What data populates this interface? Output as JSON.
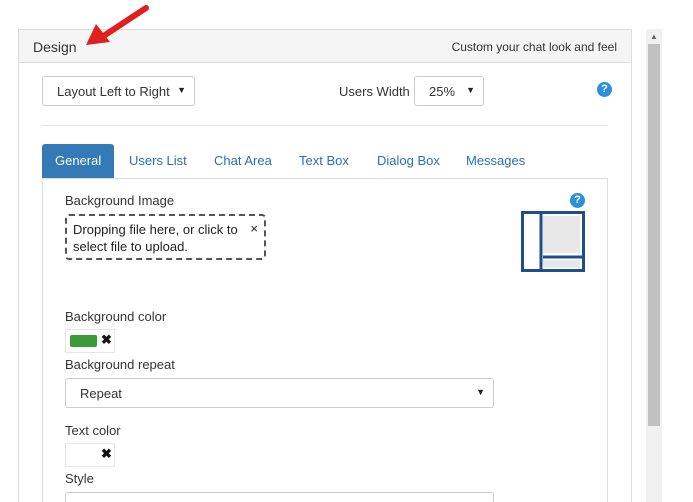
{
  "panel": {
    "title": "Design",
    "subtitle": "Custom your chat look and feel"
  },
  "layout": {
    "select_value": "Layout Left to Right",
    "users_width_label": "Users Width",
    "users_width_value": "25%",
    "help": "?"
  },
  "tabs": [
    {
      "label": "General",
      "active": true
    },
    {
      "label": "Users List",
      "active": false
    },
    {
      "label": "Chat Area",
      "active": false
    },
    {
      "label": "Text Box",
      "active": false
    },
    {
      "label": "Dialog Box",
      "active": false
    },
    {
      "label": "Messages",
      "active": false
    }
  ],
  "general": {
    "bg_image_label": "Background Image",
    "dropzone_text": "Dropping file here, or click to select file to upload.",
    "dropzone_remove": "×",
    "help": "?",
    "bg_color_label": "Background color",
    "bg_color_value": "#3a9a3a",
    "bg_color_remove": "✖",
    "bg_repeat_label": "Background repeat",
    "bg_repeat_value": "Repeat",
    "text_color_label": "Text color",
    "text_color_remove": "✖",
    "style_label": "Style"
  },
  "icons": {
    "caret": "▼",
    "scroll_up": "▲",
    "annotation": "red-arrow-icon"
  },
  "colors": {
    "accent": "#337ab7",
    "help": "#2a90d8",
    "arrow": "#e0201c",
    "thumb_border": "#1f4e8c"
  }
}
